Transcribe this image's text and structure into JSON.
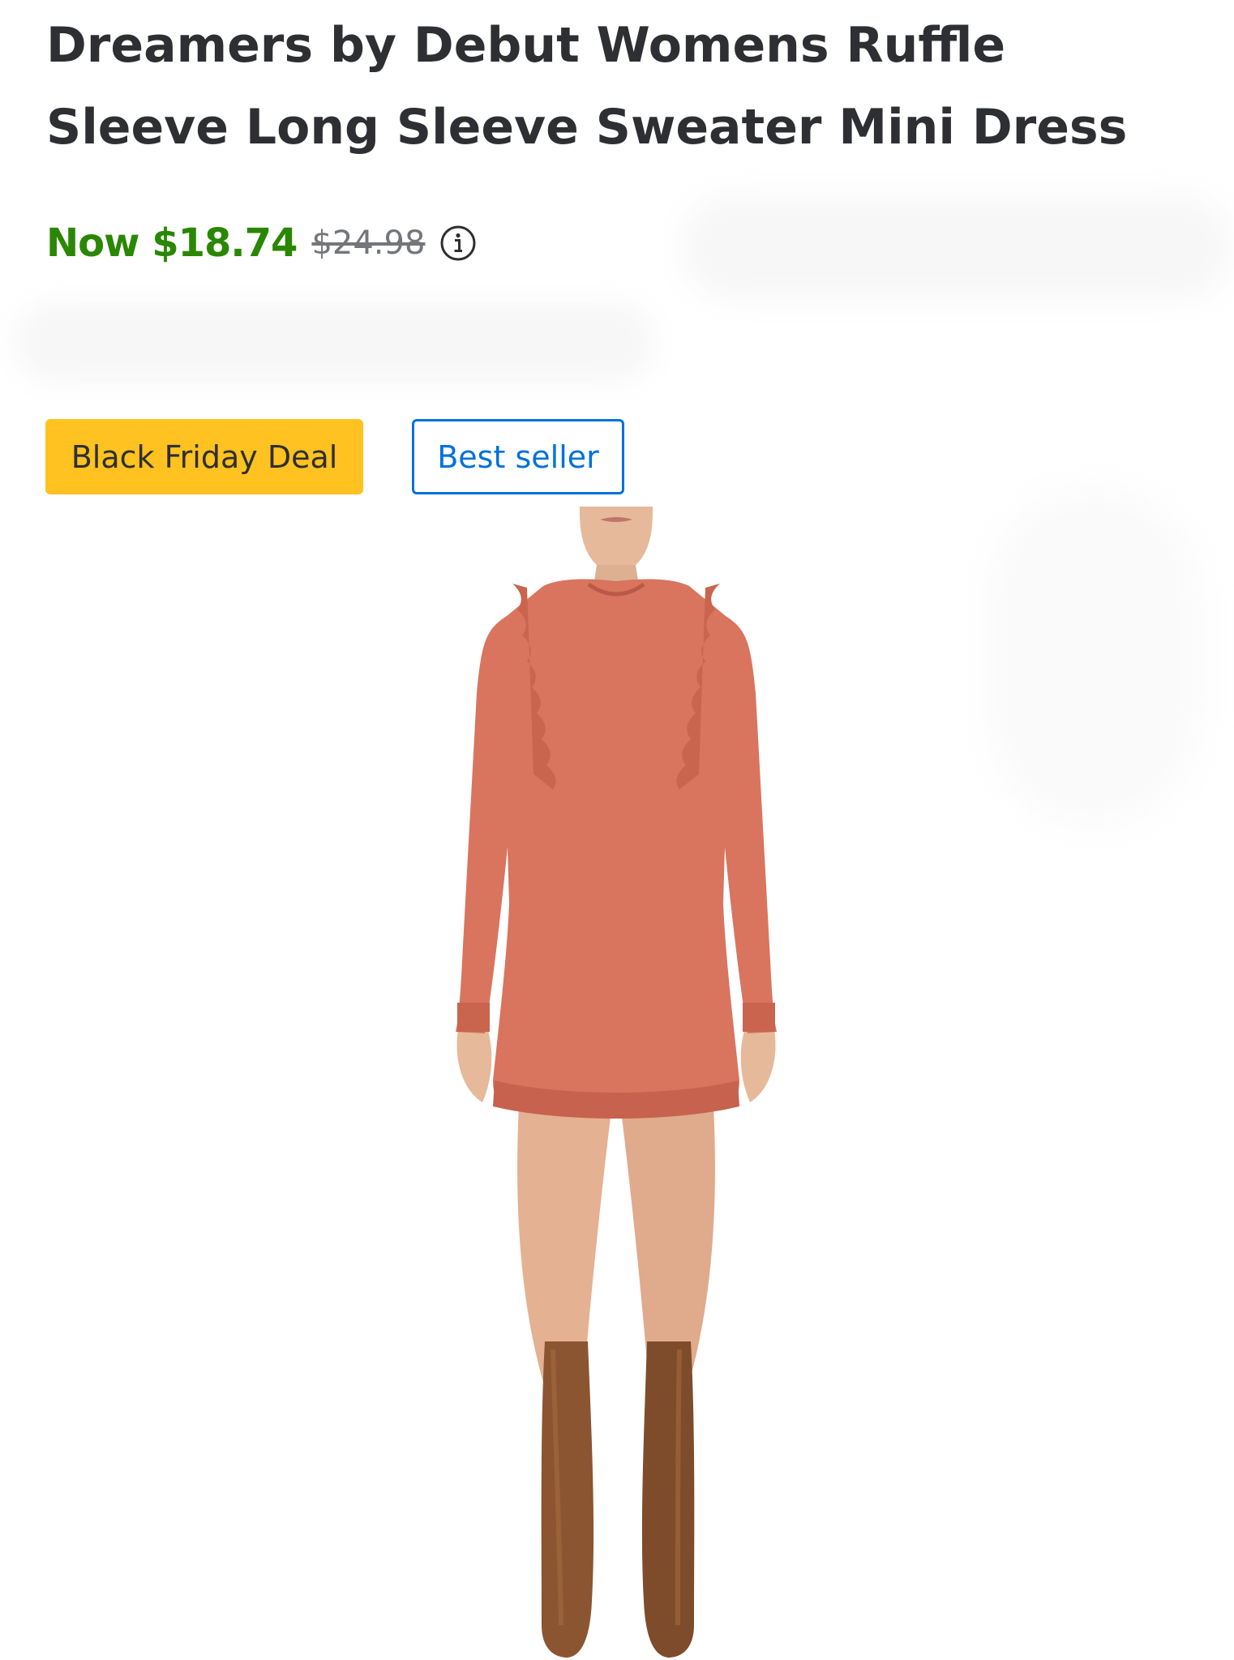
{
  "product": {
    "title": "Dreamers by Debut Womens Ruffle Sleeve Long Sleeve Sweater Mini Dress",
    "price": {
      "now": "Now $18.74",
      "was": "$24.98",
      "info_icon": "info-circle-icon"
    },
    "badges": {
      "deal": "Black Friday Deal",
      "best_seller": "Best seller"
    },
    "colors": {
      "now_price": "#2a8703",
      "deal_badge": "#ffc220",
      "best_seller_border": "#0071dc",
      "dress": "#d9745f",
      "boots": "#8a5530"
    }
  }
}
